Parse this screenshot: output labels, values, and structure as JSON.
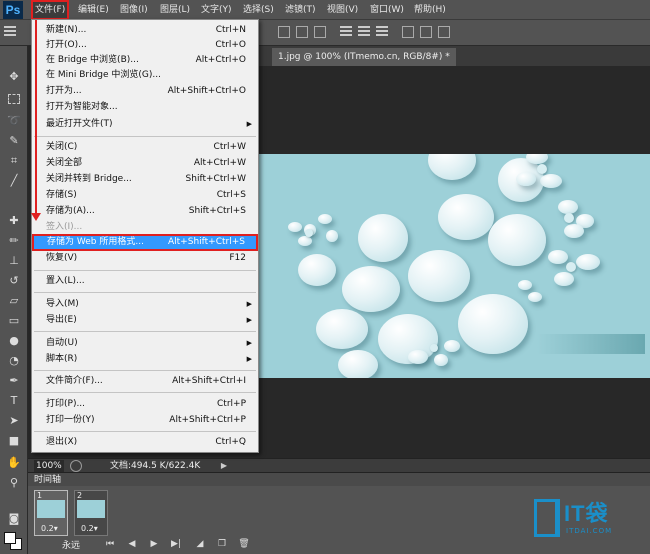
{
  "menubar": {
    "logo": "Ps",
    "items": [
      "文件(F)",
      "编辑(E)",
      "图像(I)",
      "图层(L)",
      "文字(Y)",
      "选择(S)",
      "滤镜(T)",
      "视图(V)",
      "窗口(W)",
      "帮助(H)"
    ]
  },
  "document_tab": "1.jpg @ 100% (ITmemo.cn, RGB/8#) *",
  "file_menu": [
    {
      "label": "新建(N)...",
      "shortcut": "Ctrl+N"
    },
    {
      "label": "打开(O)...",
      "shortcut": "Ctrl+O"
    },
    {
      "label": "在 Bridge 中浏览(B)...",
      "shortcut": "Alt+Ctrl+O"
    },
    {
      "label": "在 Mini Bridge 中浏览(G)...",
      "shortcut": ""
    },
    {
      "label": "打开为...",
      "shortcut": "Alt+Shift+Ctrl+O"
    },
    {
      "label": "打开为智能对象...",
      "shortcut": ""
    },
    {
      "label": "最近打开文件(T)",
      "shortcut": ""
    },
    {
      "label": "关闭(C)",
      "shortcut": "Ctrl+W"
    },
    {
      "label": "关闭全部",
      "shortcut": "Alt+Ctrl+W"
    },
    {
      "label": "关闭并转到 Bridge...",
      "shortcut": "Shift+Ctrl+W"
    },
    {
      "label": "存储(S)",
      "shortcut": "Ctrl+S"
    },
    {
      "label": "存储为(A)...",
      "shortcut": "Shift+Ctrl+S"
    },
    {
      "label": "签入(I)...",
      "shortcut": ""
    },
    {
      "label": "存储为 Web 所用格式...",
      "shortcut": "Alt+Shift+Ctrl+S"
    },
    {
      "label": "恢复(V)",
      "shortcut": "F12"
    },
    {
      "label": "置入(L)...",
      "shortcut": ""
    },
    {
      "label": "导入(M)",
      "shortcut": ""
    },
    {
      "label": "导出(E)",
      "shortcut": ""
    },
    {
      "label": "自动(U)",
      "shortcut": ""
    },
    {
      "label": "脚本(R)",
      "shortcut": ""
    },
    {
      "label": "文件简介(F)...",
      "shortcut": "Alt+Shift+Ctrl+I"
    },
    {
      "label": "打印(P)...",
      "shortcut": "Ctrl+P"
    },
    {
      "label": "打印一份(Y)",
      "shortcut": "Alt+Shift+Ctrl+P"
    },
    {
      "label": "退出(X)",
      "shortcut": "Ctrl+Q"
    }
  ],
  "status": {
    "zoom": "100%",
    "doc_info": "文档:494.5 K/622.4K"
  },
  "timeline": {
    "tab": "时间轴",
    "frames": [
      {
        "number": "1",
        "delay": "0.2▾"
      },
      {
        "number": "2",
        "delay": "0.2▾"
      }
    ],
    "loop": "永远"
  },
  "watermark": {
    "text": "IT袋",
    "sub": "ITDAI.COM"
  },
  "colors": {
    "accent_red": "#e02020",
    "highlight_blue": "#3399ff",
    "watermark_blue": "#1a8fc9",
    "artwork_teal": "#9dd0d8"
  }
}
